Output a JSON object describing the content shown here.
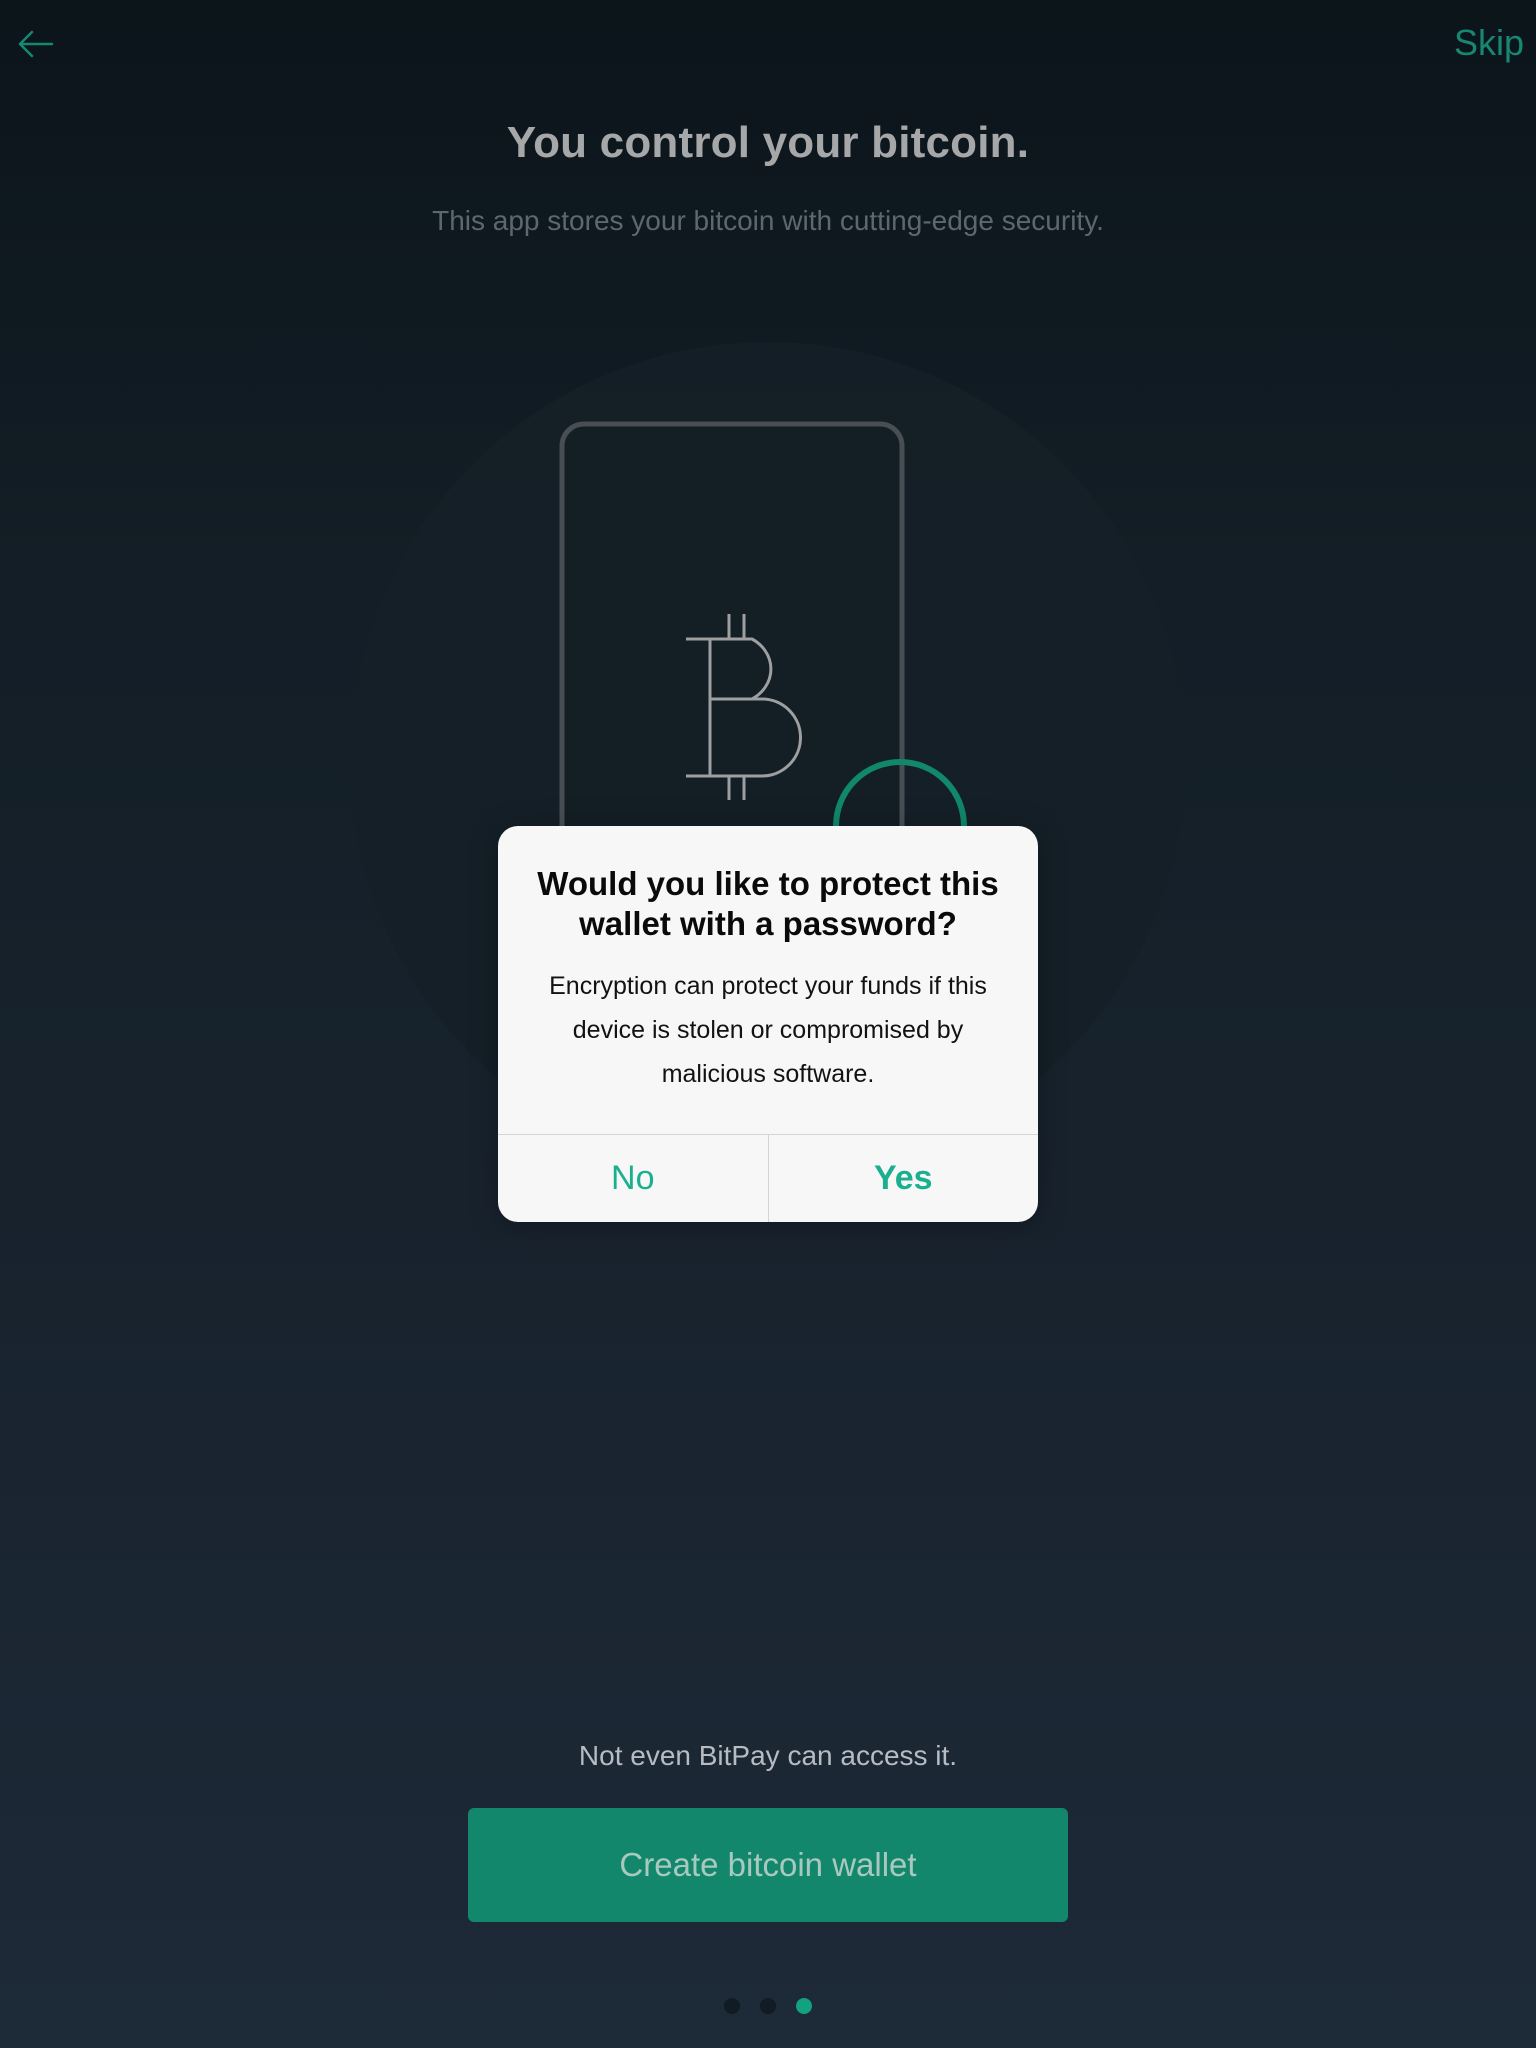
{
  "header": {
    "back_icon": "arrow-left-icon",
    "skip_label": "Skip"
  },
  "onboarding": {
    "title": "You control your bitcoin.",
    "subtitle": "This app stores your bitcoin with cutting-edge security.",
    "illustration_icons": [
      "phone-outline-icon",
      "bitcoin-icon",
      "padlock-icon"
    ],
    "footnote": "Not even BitPay can access it.",
    "cta_label": "Create bitcoin wallet",
    "pager": {
      "total": 3,
      "active_index": 2
    }
  },
  "dialog": {
    "title": "Would you like to protect this wallet with a password?",
    "message": "Encryption can protect your funds if this device is stolen or compromised by malicious software.",
    "no_label": "No",
    "yes_label": "Yes"
  },
  "colors": {
    "accent": "#1aa287",
    "cta_background": "#13876c",
    "dialog_background": "#f7f7f7",
    "page_background_top": "#0c161c",
    "page_background_bottom": "#223040"
  }
}
